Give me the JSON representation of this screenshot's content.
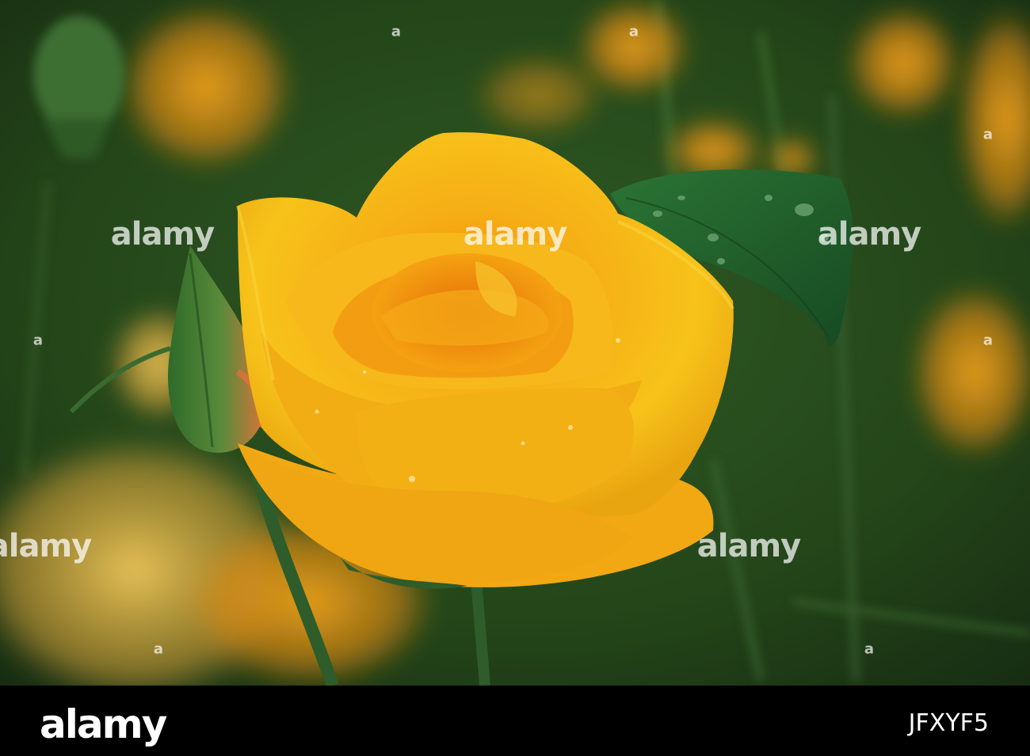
{
  "photo": {
    "subject": "yellow-rose",
    "colors": {
      "petal": "#f5b412",
      "petal_deep": "#e88a0a",
      "leaf": "#1f5a2a",
      "background": "#2a4a22"
    }
  },
  "watermark": {
    "text": "alamy",
    "mark": "a"
  },
  "footer": {
    "brand": "alamy",
    "image_id": "JFXYF5"
  }
}
